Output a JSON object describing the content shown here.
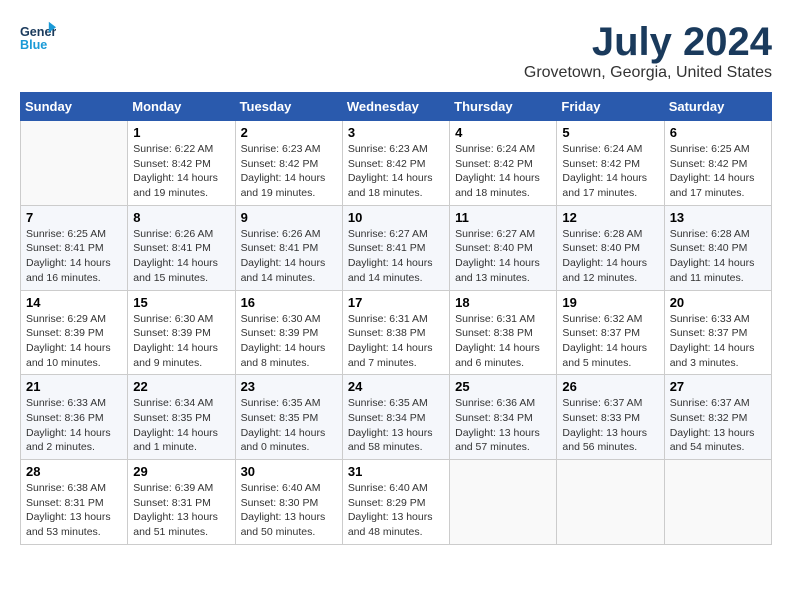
{
  "header": {
    "logo_line1": "General",
    "logo_line2": "Blue",
    "month_title": "July 2024",
    "location": "Grovetown, Georgia, United States"
  },
  "weekdays": [
    "Sunday",
    "Monday",
    "Tuesday",
    "Wednesday",
    "Thursday",
    "Friday",
    "Saturday"
  ],
  "weeks": [
    [
      {
        "day": "",
        "info": ""
      },
      {
        "day": "1",
        "info": "Sunrise: 6:22 AM\nSunset: 8:42 PM\nDaylight: 14 hours\nand 19 minutes."
      },
      {
        "day": "2",
        "info": "Sunrise: 6:23 AM\nSunset: 8:42 PM\nDaylight: 14 hours\nand 19 minutes."
      },
      {
        "day": "3",
        "info": "Sunrise: 6:23 AM\nSunset: 8:42 PM\nDaylight: 14 hours\nand 18 minutes."
      },
      {
        "day": "4",
        "info": "Sunrise: 6:24 AM\nSunset: 8:42 PM\nDaylight: 14 hours\nand 18 minutes."
      },
      {
        "day": "5",
        "info": "Sunrise: 6:24 AM\nSunset: 8:42 PM\nDaylight: 14 hours\nand 17 minutes."
      },
      {
        "day": "6",
        "info": "Sunrise: 6:25 AM\nSunset: 8:42 PM\nDaylight: 14 hours\nand 17 minutes."
      }
    ],
    [
      {
        "day": "7",
        "info": "Sunrise: 6:25 AM\nSunset: 8:41 PM\nDaylight: 14 hours\nand 16 minutes."
      },
      {
        "day": "8",
        "info": "Sunrise: 6:26 AM\nSunset: 8:41 PM\nDaylight: 14 hours\nand 15 minutes."
      },
      {
        "day": "9",
        "info": "Sunrise: 6:26 AM\nSunset: 8:41 PM\nDaylight: 14 hours\nand 14 minutes."
      },
      {
        "day": "10",
        "info": "Sunrise: 6:27 AM\nSunset: 8:41 PM\nDaylight: 14 hours\nand 14 minutes."
      },
      {
        "day": "11",
        "info": "Sunrise: 6:27 AM\nSunset: 8:40 PM\nDaylight: 14 hours\nand 13 minutes."
      },
      {
        "day": "12",
        "info": "Sunrise: 6:28 AM\nSunset: 8:40 PM\nDaylight: 14 hours\nand 12 minutes."
      },
      {
        "day": "13",
        "info": "Sunrise: 6:28 AM\nSunset: 8:40 PM\nDaylight: 14 hours\nand 11 minutes."
      }
    ],
    [
      {
        "day": "14",
        "info": "Sunrise: 6:29 AM\nSunset: 8:39 PM\nDaylight: 14 hours\nand 10 minutes."
      },
      {
        "day": "15",
        "info": "Sunrise: 6:30 AM\nSunset: 8:39 PM\nDaylight: 14 hours\nand 9 minutes."
      },
      {
        "day": "16",
        "info": "Sunrise: 6:30 AM\nSunset: 8:39 PM\nDaylight: 14 hours\nand 8 minutes."
      },
      {
        "day": "17",
        "info": "Sunrise: 6:31 AM\nSunset: 8:38 PM\nDaylight: 14 hours\nand 7 minutes."
      },
      {
        "day": "18",
        "info": "Sunrise: 6:31 AM\nSunset: 8:38 PM\nDaylight: 14 hours\nand 6 minutes."
      },
      {
        "day": "19",
        "info": "Sunrise: 6:32 AM\nSunset: 8:37 PM\nDaylight: 14 hours\nand 5 minutes."
      },
      {
        "day": "20",
        "info": "Sunrise: 6:33 AM\nSunset: 8:37 PM\nDaylight: 14 hours\nand 3 minutes."
      }
    ],
    [
      {
        "day": "21",
        "info": "Sunrise: 6:33 AM\nSunset: 8:36 PM\nDaylight: 14 hours\nand 2 minutes."
      },
      {
        "day": "22",
        "info": "Sunrise: 6:34 AM\nSunset: 8:35 PM\nDaylight: 14 hours\nand 1 minute."
      },
      {
        "day": "23",
        "info": "Sunrise: 6:35 AM\nSunset: 8:35 PM\nDaylight: 14 hours\nand 0 minutes."
      },
      {
        "day": "24",
        "info": "Sunrise: 6:35 AM\nSunset: 8:34 PM\nDaylight: 13 hours\nand 58 minutes."
      },
      {
        "day": "25",
        "info": "Sunrise: 6:36 AM\nSunset: 8:34 PM\nDaylight: 13 hours\nand 57 minutes."
      },
      {
        "day": "26",
        "info": "Sunrise: 6:37 AM\nSunset: 8:33 PM\nDaylight: 13 hours\nand 56 minutes."
      },
      {
        "day": "27",
        "info": "Sunrise: 6:37 AM\nSunset: 8:32 PM\nDaylight: 13 hours\nand 54 minutes."
      }
    ],
    [
      {
        "day": "28",
        "info": "Sunrise: 6:38 AM\nSunset: 8:31 PM\nDaylight: 13 hours\nand 53 minutes."
      },
      {
        "day": "29",
        "info": "Sunrise: 6:39 AM\nSunset: 8:31 PM\nDaylight: 13 hours\nand 51 minutes."
      },
      {
        "day": "30",
        "info": "Sunrise: 6:40 AM\nSunset: 8:30 PM\nDaylight: 13 hours\nand 50 minutes."
      },
      {
        "day": "31",
        "info": "Sunrise: 6:40 AM\nSunset: 8:29 PM\nDaylight: 13 hours\nand 48 minutes."
      },
      {
        "day": "",
        "info": ""
      },
      {
        "day": "",
        "info": ""
      },
      {
        "day": "",
        "info": ""
      }
    ]
  ]
}
